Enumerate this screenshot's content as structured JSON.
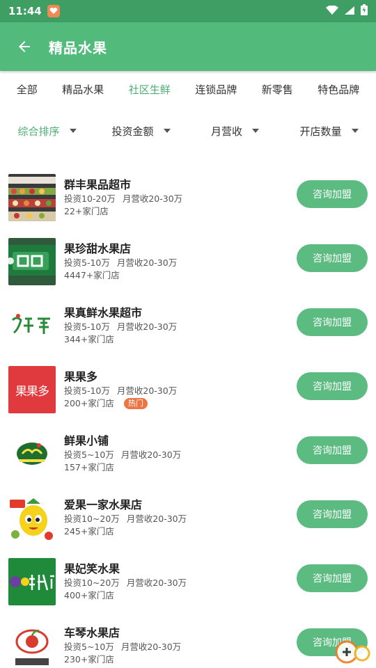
{
  "status_bar": {
    "time": "11:44"
  },
  "app_bar": {
    "title": "精品水果"
  },
  "tabs": [
    {
      "label": "全部",
      "active": false
    },
    {
      "label": "精品水果",
      "active": false
    },
    {
      "label": "社区生鲜",
      "active": true
    },
    {
      "label": "连锁品牌",
      "active": false
    },
    {
      "label": "新零售",
      "active": false
    },
    {
      "label": "特色品牌",
      "active": false
    }
  ],
  "filters": [
    {
      "label": "综合排序",
      "active": true
    },
    {
      "label": "投资金额",
      "active": false
    },
    {
      "label": "月营收",
      "active": false
    },
    {
      "label": "开店数量",
      "active": false
    }
  ],
  "list": [
    {
      "name": "群丰果品超市",
      "invest": "投资10-20万",
      "revenue": "月营收20-30万",
      "stores": "22+家门店",
      "button": "咨询加盟"
    },
    {
      "name": "果珍甜水果店",
      "invest": "投资5-10万",
      "revenue": "月营收20-30万",
      "stores": "4447+家门店",
      "button": "咨询加盟"
    },
    {
      "name": "果真鲜水果超市",
      "invest": "投资5-10万",
      "revenue": "月营收20-30万",
      "stores": "344+家门店",
      "button": "咨询加盟"
    },
    {
      "name": "果果多",
      "invest": "投资5-10万",
      "revenue": "月营收20-30万",
      "stores": "200+家门店",
      "badge": "热门",
      "button": "咨询加盟",
      "logo_text": "果果多"
    },
    {
      "name": "鲜果小铺",
      "invest": "投资5~10万",
      "revenue": "月营收20-30万",
      "stores": "157+家门店",
      "button": "咨询加盟"
    },
    {
      "name": "爱果一家水果店",
      "invest": "投资10~20万",
      "revenue": "月营收20-30万",
      "stores": "245+家门店",
      "button": "咨询加盟"
    },
    {
      "name": "果妃笑水果",
      "invest": "投资10~20万",
      "revenue": "月营收20-30万",
      "stores": "400+家门店",
      "button": "咨询加盟"
    },
    {
      "name": "车琴水果店",
      "invest": "投资5~10万",
      "revenue": "月营收20-30万",
      "stores": "230+家门店",
      "button": "咨询加盟"
    }
  ],
  "colors": {
    "primary": "#52bb7b",
    "status": "#3e9e63",
    "active_text": "#4caf72",
    "button": "#5cbb80",
    "badge": "#ee7443"
  }
}
